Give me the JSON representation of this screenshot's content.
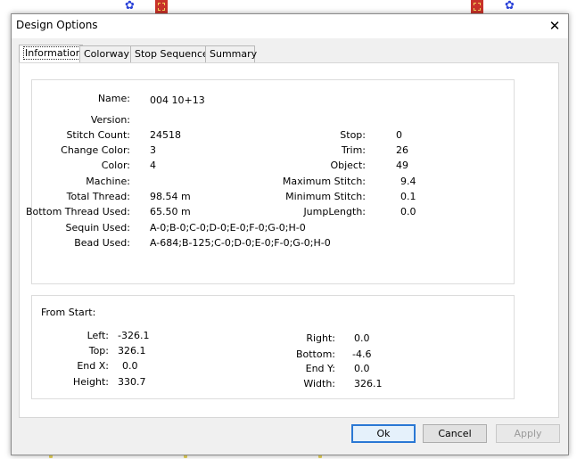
{
  "window": {
    "title": "Design Options",
    "close_glyph": "✕"
  },
  "tabs": [
    "Information",
    "Colorway",
    "Stop Sequence",
    "Summary"
  ],
  "info": {
    "left": [
      {
        "label": "Name:",
        "value": "004 10+13"
      },
      {
        "label": "Version:",
        "value": ""
      },
      {
        "label": "Stitch Count:",
        "value": "24518"
      },
      {
        "label": "Change Color:",
        "value": "3"
      },
      {
        "label": "Color:",
        "value": "4"
      },
      {
        "label": "Machine:",
        "value": ""
      },
      {
        "label": "Total Thread:",
        "value": "98.54 m"
      },
      {
        "label": "Bottom Thread Used:",
        "value": "65.50 m"
      },
      {
        "label": "Sequin Used:",
        "value": "A-0;B-0;C-0;D-0;E-0;F-0;G-0;H-0"
      },
      {
        "label": "Bead Used:",
        "value": "A-684;B-125;C-0;D-0;E-0;F-0;G-0;H-0"
      }
    ],
    "right": [
      {
        "label": "Stop:",
        "value": "0"
      },
      {
        "label": "Trim:",
        "value": "26"
      },
      {
        "label": "Object:",
        "value": "49"
      },
      {
        "label": "Maximum Stitch:",
        "value": "9.4"
      },
      {
        "label": "Minimum Stitch:",
        "value": "0.1"
      },
      {
        "label": "JumpLength:",
        "value": "0.0"
      }
    ]
  },
  "from_start": {
    "title": "From Start:",
    "left": [
      {
        "label": "Left:",
        "value": "-326.1"
      },
      {
        "label": "Top:",
        "value": "326.1"
      },
      {
        "label": "End X:",
        "value": "0.0"
      },
      {
        "label": "Height:",
        "value": "330.7"
      }
    ],
    "right": [
      {
        "label": "Right:",
        "value": "0.0"
      },
      {
        "label": "Bottom:",
        "value": "-4.6"
      },
      {
        "label": "End Y:",
        "value": "0.0"
      },
      {
        "label": "Width:",
        "value": "326.1"
      }
    ]
  },
  "buttons": {
    "ok": "Ok",
    "cancel": "Cancel",
    "apply": "Apply"
  },
  "icons": {
    "flower": "✿"
  }
}
